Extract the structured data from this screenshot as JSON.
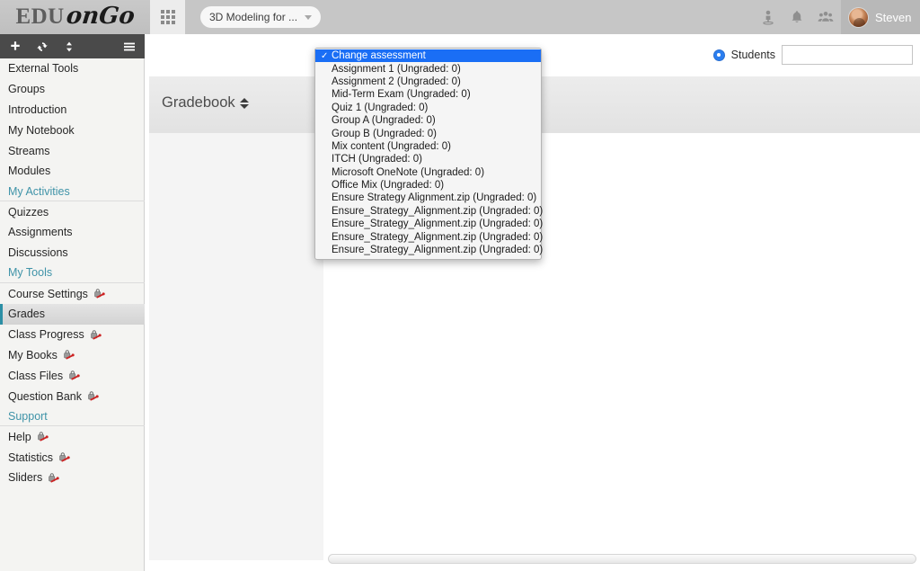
{
  "header": {
    "logo_primary": "EDU",
    "logo_secondary": "onGo",
    "waffle_icon": "grid-apps-icon",
    "course_selector": {
      "label": "3D Modeling for ...",
      "caret_icon": "chevron-down-icon"
    },
    "icons": [
      {
        "name": "presenter-icon"
      },
      {
        "name": "bell-icon"
      },
      {
        "name": "people-icon"
      }
    ],
    "user": {
      "name": "Steven",
      "avatar": "user-avatar"
    }
  },
  "sidebar": {
    "toolbar": [
      {
        "name": "add-icon",
        "glyph": "plus"
      },
      {
        "name": "refresh-icon",
        "glyph": "refresh"
      },
      {
        "name": "sort-icon",
        "glyph": "sort"
      },
      {
        "name": "menu-icon",
        "glyph": "hamburger"
      }
    ],
    "items": [
      {
        "label": "External Tools",
        "type": "item",
        "locked": false
      },
      {
        "label": "Groups",
        "type": "item",
        "locked": false
      },
      {
        "label": "Introduction",
        "type": "item",
        "locked": false
      },
      {
        "label": "My Notebook",
        "type": "item",
        "locked": false
      },
      {
        "label": "Streams",
        "type": "item",
        "locked": false
      },
      {
        "label": "Modules",
        "type": "item",
        "locked": false
      },
      {
        "label": "My Activities",
        "type": "section",
        "locked": false
      },
      {
        "label": "Quizzes",
        "type": "item",
        "locked": false
      },
      {
        "label": "Assignments",
        "type": "item",
        "locked": false
      },
      {
        "label": "Discussions",
        "type": "item",
        "locked": false
      },
      {
        "label": "My Tools",
        "type": "section",
        "locked": false
      },
      {
        "label": "Course Settings",
        "type": "item",
        "locked": true
      },
      {
        "label": "Grades",
        "type": "item",
        "locked": false,
        "active": true
      },
      {
        "label": "Class Progress",
        "type": "item",
        "locked": true
      },
      {
        "label": "My Books",
        "type": "item",
        "locked": true
      },
      {
        "label": "Class Files",
        "type": "item",
        "locked": true
      },
      {
        "label": "Question Bank",
        "type": "item",
        "locked": true
      },
      {
        "label": "Support",
        "type": "section",
        "locked": false
      },
      {
        "label": "Help",
        "type": "item",
        "locked": true
      },
      {
        "label": "Statistics",
        "type": "item",
        "locked": true
      },
      {
        "label": "Sliders",
        "type": "item",
        "locked": true
      }
    ]
  },
  "main": {
    "gradebook_title": "Gradebook",
    "sort_icon": "sort-updown-icon",
    "filter": {
      "radio_label": "Students",
      "radio_selected": true,
      "search_value": "",
      "search_placeholder": ""
    },
    "scrollbar": "horizontal-scrollbar"
  },
  "dropdown": {
    "items": [
      {
        "label": "Change assessment",
        "selected": true
      },
      {
        "label": "Assignment 1 (Ungraded: 0)",
        "selected": false
      },
      {
        "label": "Assignment 2 (Ungraded: 0)",
        "selected": false
      },
      {
        "label": "Mid-Term Exam (Ungraded: 0)",
        "selected": false
      },
      {
        "label": "Quiz 1 (Ungraded: 0)",
        "selected": false
      },
      {
        "label": "Group A (Ungraded: 0)",
        "selected": false
      },
      {
        "label": "Group B (Ungraded: 0)",
        "selected": false
      },
      {
        "label": "Mix content (Ungraded: 0)",
        "selected": false
      },
      {
        "label": "ITCH (Ungraded: 0)",
        "selected": false
      },
      {
        "label": "Microsoft OneNote (Ungraded: 0)",
        "selected": false
      },
      {
        "label": "Office Mix (Ungraded: 0)",
        "selected": false
      },
      {
        "label": "Ensure Strategy Alignment.zip (Ungraded: 0)",
        "selected": false
      },
      {
        "label": "Ensure_Strategy_Alignment.zip (Ungraded: 0)",
        "selected": false
      },
      {
        "label": "Ensure_Strategy_Alignment.zip (Ungraded: 0)",
        "selected": false
      },
      {
        "label": "Ensure_Strategy_Alignment.zip (Ungraded: 0)",
        "selected": false
      },
      {
        "label": "Ensure_Strategy_Alignment.zip (Ungraded: 0)",
        "selected": false
      }
    ],
    "checkmark": "✓"
  },
  "colors": {
    "accent_teal": "#2c8fa5",
    "selection_blue": "#1a6ef5",
    "radio_blue": "#2a7ef0",
    "lock_red": "#cc2222"
  }
}
